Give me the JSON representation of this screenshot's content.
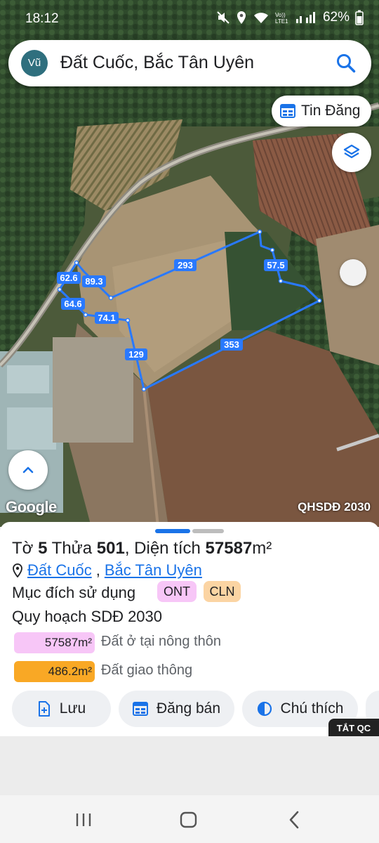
{
  "status_bar": {
    "time": "18:12",
    "battery": "62%",
    "icons": [
      "mute-icon",
      "location-icon",
      "wifi-icon",
      "volte-icon",
      "signal-icon"
    ]
  },
  "search": {
    "avatar": "Vũ",
    "query": "Đất Cuốc, Bắc Tân Uyên"
  },
  "map": {
    "tin_dang_label": "Tin Đăng",
    "provider": "Google",
    "layer_label": "QHSDĐ 2030",
    "boundary_color": "#2979ff",
    "edge_labels": [
      "293",
      "57.5",
      "62.6",
      "89.3",
      "64.6",
      "74.1",
      "129",
      "353"
    ]
  },
  "parcel": {
    "sheet_label": "Tờ",
    "sheet_no": "5",
    "parcel_label": "Thửa",
    "parcel_no": "501",
    "area_label": "Diện tích",
    "area_value": "57587",
    "area_unit": "m²",
    "commune": "Đất Cuốc",
    "separator": ",",
    "district": "Bắc Tân Uyên",
    "purpose_label": "Mục đích sử dụng",
    "purpose_tags": [
      {
        "code": "ONT",
        "color": "#f7c6f7"
      },
      {
        "code": "CLN",
        "color": "#fbd4a3"
      }
    ],
    "plan_title": "Quy hoạch SDĐ 2030",
    "plan_rows": [
      {
        "area": "57587m²",
        "description": "Đất ở tại nông thôn",
        "color": "#f7c6f7"
      },
      {
        "area": "486.2m²",
        "description": "Đất giao thông",
        "color": "#f9a825"
      }
    ]
  },
  "actions": {
    "save": "Lưu",
    "post": "Đăng bán",
    "legend": "Chú thích"
  },
  "ad_badge": "TẮT QC",
  "nav": [
    "recents-icon",
    "home-icon",
    "back-icon"
  ]
}
